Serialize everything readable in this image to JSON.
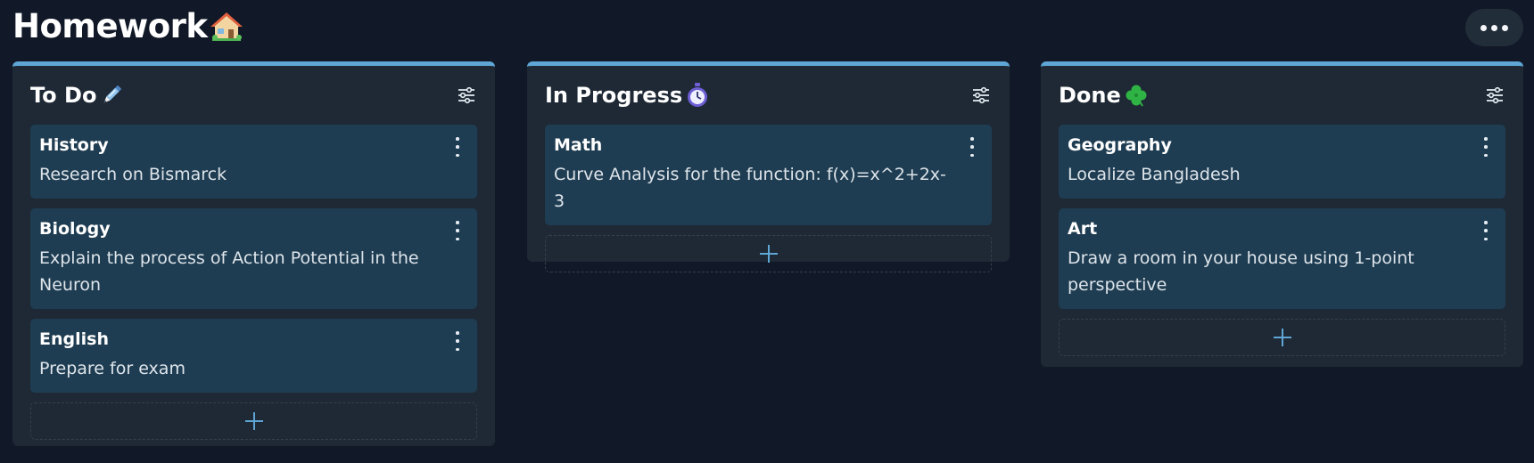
{
  "board": {
    "title": "Homework",
    "title_icon": "house-icon",
    "more_icon": "more-horizontal-icon"
  },
  "colors": {
    "background": "#111827",
    "column": "#1e2935",
    "card": "#1f3d52",
    "accent": "#5fa6d6"
  },
  "columns": [
    {
      "title": "To Do",
      "emoji": "pen-icon",
      "cards": [
        {
          "title": "History",
          "text": "Research on Bismarck"
        },
        {
          "title": "Biology",
          "text": "Explain the process of Action Potential in the Neuron"
        },
        {
          "title": "English",
          "text": "Prepare for exam"
        }
      ]
    },
    {
      "title": "In Progress",
      "emoji": "stopwatch-icon",
      "cards": [
        {
          "title": "Math",
          "text": "Curve Analysis for the function: f(x)=x^2+2x-3"
        }
      ]
    },
    {
      "title": "Done",
      "emoji": "clover-icon",
      "cards": [
        {
          "title": "Geography",
          "text": "Localize Bangladesh"
        },
        {
          "title": "Art",
          "text": "Draw a room in your house using 1-point perspective"
        }
      ]
    }
  ]
}
